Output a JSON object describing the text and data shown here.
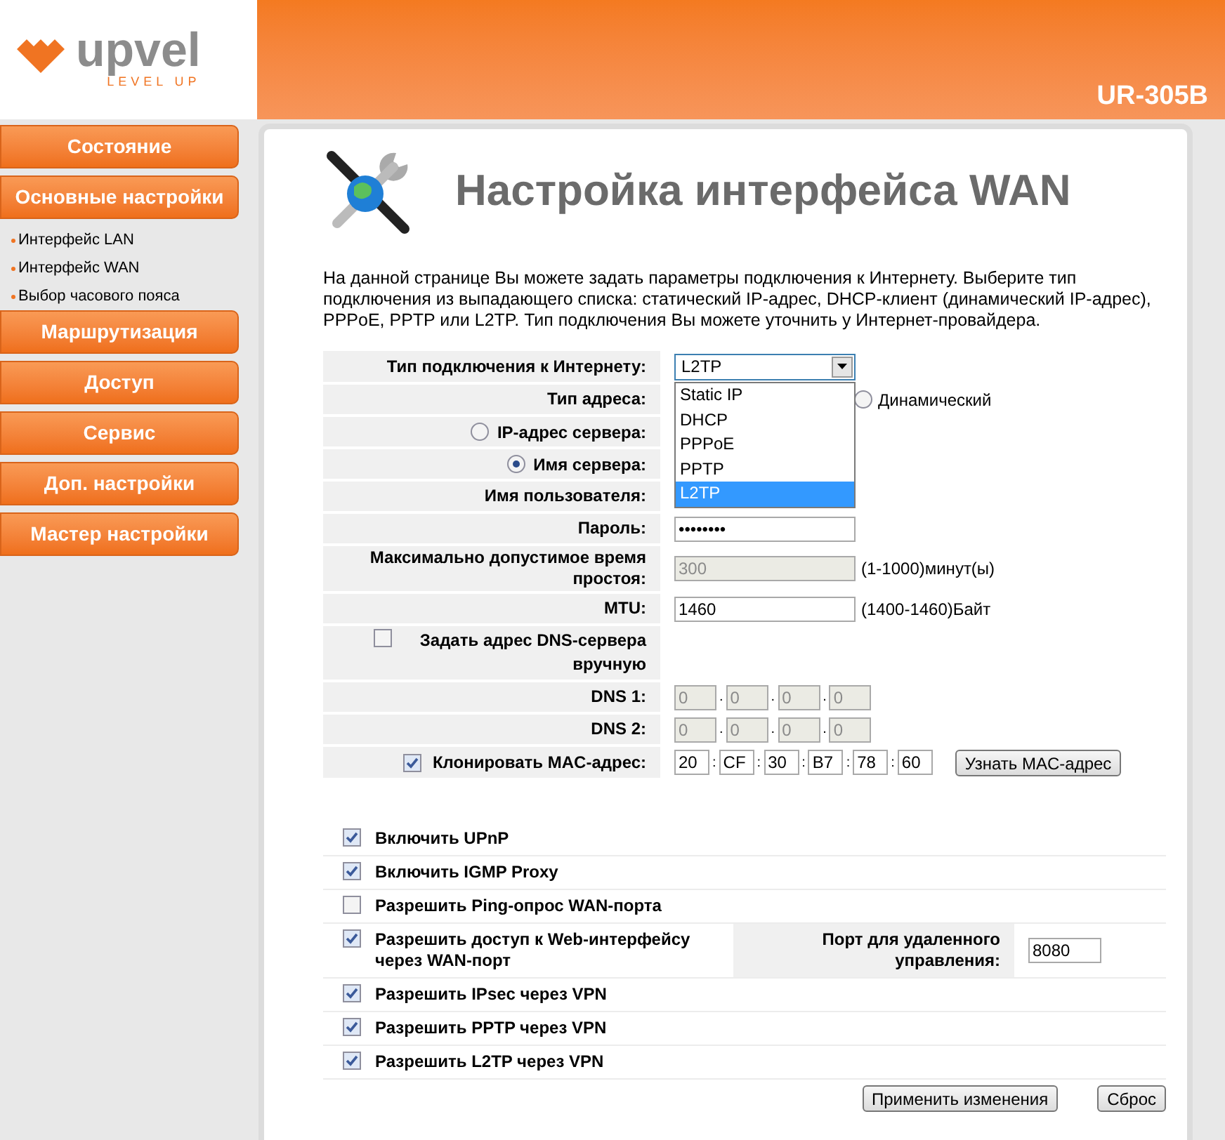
{
  "header": {
    "brand": "upvel",
    "tagline": "LEVEL UP",
    "model": "UR-305B"
  },
  "sidebar": [
    {
      "kind": "button",
      "label": "Состояние"
    },
    {
      "kind": "button",
      "label": "Основные настройки"
    },
    {
      "kind": "link",
      "label": "Интерфейс LAN"
    },
    {
      "kind": "link",
      "label": "Интерфейс WAN"
    },
    {
      "kind": "link",
      "label": "Выбор часового пояса"
    },
    {
      "kind": "button",
      "label": "Маршрутизация"
    },
    {
      "kind": "button",
      "label": "Доступ"
    },
    {
      "kind": "button",
      "label": "Сервис"
    },
    {
      "kind": "button",
      "label": "Доп. настройки"
    },
    {
      "kind": "button",
      "label": "Мастер настройки"
    }
  ],
  "page": {
    "title": "Настройка интерфейса WAN",
    "description": "На данной странице Вы можете задать параметры подключения к Интернету. Выберите тип подключения из выпадающего списка: статический IP-адрес, DHCP-клиент (динамический IP-адрес), PPPoE, PPTP или L2TP. Тип подключения Вы можете уточнить у Интернет-провайдера."
  },
  "connection_type": {
    "label": "Тип подключения к Интернету:",
    "value": "L2TP",
    "expanded": true,
    "options": [
      {
        "label": "Static IP",
        "selected": false
      },
      {
        "label": "DHCP",
        "selected": false
      },
      {
        "label": "PPPoE",
        "selected": false
      },
      {
        "label": "PPTP",
        "selected": false
      },
      {
        "label": "L2TP",
        "selected": true
      }
    ]
  },
  "address_type": {
    "label": "Тип адреса:",
    "option": "Динамический",
    "selected": false
  },
  "server_ip": {
    "label": "IP-адрес сервера:",
    "selected": false
  },
  "server_name": {
    "label": "Имя сервера:",
    "selected": true
  },
  "username": {
    "label": "Имя пользователя:"
  },
  "password": {
    "label": "Пароль:",
    "value": "••••••••"
  },
  "idle_time": {
    "label": "Максимально допустимое время простоя:",
    "value": "300",
    "disabled": true,
    "hint": "(1-1000)минут(ы)"
  },
  "mtu": {
    "label": "MTU:",
    "value": "1460",
    "hint": "(1400-1460)Байт"
  },
  "dns_manual": {
    "label": "Задать адрес DNS-сервера вручную",
    "checked": false
  },
  "dns": [
    {
      "label": "DNS 1:",
      "octets": [
        "0",
        "0",
        "0",
        "0"
      ],
      "separator": ".",
      "disabled": true
    },
    {
      "label": "DNS 2:",
      "octets": [
        "0",
        "0",
        "0",
        "0"
      ],
      "separator": ".",
      "disabled": true
    }
  ],
  "clone_mac": {
    "label": "Клонировать MAC-адрес:",
    "checked": true,
    "octets": [
      "20",
      "CF",
      "30",
      "B7",
      "78",
      "60"
    ],
    "separator": ":",
    "button": "Узнать MAC-адрес"
  },
  "options": [
    {
      "label": "Включить UPnP",
      "checked": true
    },
    {
      "label": "Включить IGMP Proxy",
      "checked": true
    },
    {
      "label": "Разрешить Ping-опрос WAN-порта",
      "checked": false
    },
    {
      "label": "Разрешить доступ к Web-интерфейсу через WAN-порт",
      "checked": true,
      "port_label": "Порт для удаленного управления:",
      "port_value": "8080"
    },
    {
      "label": "Разрешить IPsec через VPN",
      "checked": true
    },
    {
      "label": "Разрешить PPTP через VPN",
      "checked": true
    },
    {
      "label": "Разрешить L2TP через VPN",
      "checked": true
    }
  ],
  "buttons": {
    "apply": "Применить изменения",
    "reset": "Сброс"
  }
}
